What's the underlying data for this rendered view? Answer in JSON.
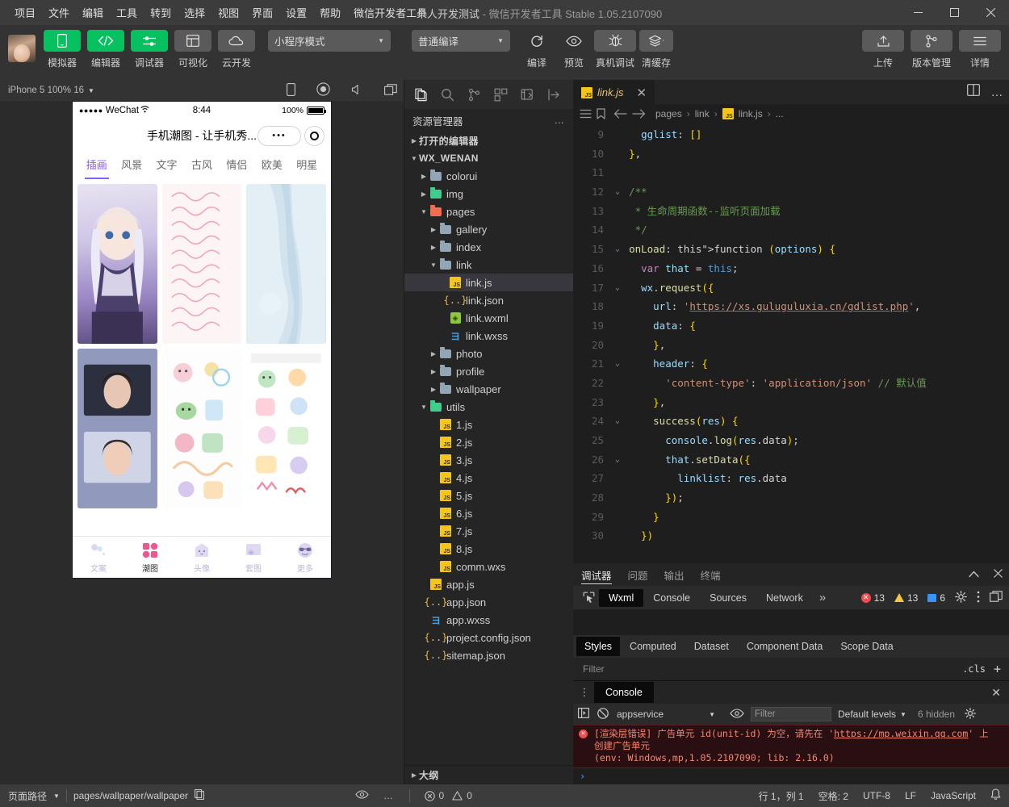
{
  "titlebar": {
    "menus": [
      "项目",
      "文件",
      "编辑",
      "工具",
      "转到",
      "选择",
      "视图",
      "界面",
      "设置",
      "帮助",
      "微信开发者工具"
    ],
    "project_name": "个人开发测试",
    "app_name": "微信开发者工具 Stable 1.05.2107090",
    "separator": "-",
    "minimize": "—",
    "maximize": "▢",
    "close": "✕"
  },
  "toolbar": {
    "buttons": [
      {
        "label": "模拟器",
        "icon": "simulator-icon",
        "style": "green"
      },
      {
        "label": "编辑器",
        "icon": "code-icon",
        "style": "green"
      },
      {
        "label": "调试器",
        "icon": "debugger-icon",
        "style": "green"
      },
      {
        "label": "可视化",
        "icon": "layout-icon",
        "style": "grey"
      },
      {
        "label": "云开发",
        "icon": "cloud-icon",
        "style": "grey"
      }
    ],
    "mode_select": "小程序模式",
    "compile_select": "普通编译",
    "actions": [
      {
        "label": "编译",
        "icon": "refresh-icon"
      },
      {
        "label": "预览",
        "icon": "eye-icon"
      },
      {
        "label": "真机调试",
        "icon": "bug-icon"
      },
      {
        "label": "清缓存",
        "icon": "layers-icon"
      }
    ],
    "right_actions": [
      {
        "label": "上传",
        "icon": "upload-icon"
      },
      {
        "label": "版本管理",
        "icon": "branch-icon"
      },
      {
        "label": "详情",
        "icon": "menu-icon"
      }
    ]
  },
  "simulator": {
    "device_label": "iPhone 5 100% 16",
    "icons": [
      "phone-rotate-icon",
      "record-icon",
      "volume-icon",
      "screenshot-icon"
    ],
    "phone": {
      "status": {
        "signal_dots": "●●●●●",
        "carrier": "WeChat",
        "wifi": "⌃",
        "time": "8:44",
        "battery_pct": "100%"
      },
      "nav_title": "手机潮图 - 让手机秀...",
      "capsule_dots": "•••",
      "categories": [
        {
          "label": "插画",
          "active": true
        },
        {
          "label": "风景",
          "active": false
        },
        {
          "label": "文字",
          "active": false
        },
        {
          "label": "古风",
          "active": false
        },
        {
          "label": "情侣",
          "active": false
        },
        {
          "label": "欧美",
          "active": false
        },
        {
          "label": "明星",
          "active": false
        }
      ],
      "tabbar": [
        {
          "label": "文案",
          "icon": "balloon-icon",
          "active": false
        },
        {
          "label": "潮图",
          "icon": "grid-icon",
          "active": true
        },
        {
          "label": "头像",
          "icon": "ghost-icon",
          "active": false
        },
        {
          "label": "套图",
          "icon": "image-icon",
          "active": false
        },
        {
          "label": "更多",
          "icon": "emoji-icon",
          "active": false
        }
      ]
    }
  },
  "explorer": {
    "activity_icons": [
      "files-icon",
      "search-icon",
      "source-control-icon",
      "extensions-icon",
      "debug-icon",
      "collapse-icon"
    ],
    "title": "资源管理器",
    "more": "…",
    "open_editors": "打开的编辑器",
    "project_root": "WX_WENAN",
    "outline": "大纲",
    "tree": [
      {
        "label": "colorui",
        "depth": 1,
        "type": "folder",
        "arrow": "right",
        "selected": false
      },
      {
        "label": "img",
        "depth": 1,
        "type": "folder-green",
        "arrow": "right",
        "selected": false
      },
      {
        "label": "pages",
        "depth": 1,
        "type": "folder-red",
        "arrow": "down",
        "selected": false
      },
      {
        "label": "gallery",
        "depth": 2,
        "type": "folder",
        "arrow": "right",
        "selected": false
      },
      {
        "label": "index",
        "depth": 2,
        "type": "folder",
        "arrow": "right",
        "selected": false
      },
      {
        "label": "link",
        "depth": 2,
        "type": "folder",
        "arrow": "down",
        "selected": false
      },
      {
        "label": "link.js",
        "depth": 3,
        "type": "js",
        "arrow": "none",
        "selected": true
      },
      {
        "label": "link.json",
        "depth": 3,
        "type": "json",
        "arrow": "none",
        "selected": false
      },
      {
        "label": "link.wxml",
        "depth": 3,
        "type": "wxml",
        "arrow": "none",
        "selected": false
      },
      {
        "label": "link.wxss",
        "depth": 3,
        "type": "wxss",
        "arrow": "none",
        "selected": false
      },
      {
        "label": "photo",
        "depth": 2,
        "type": "folder",
        "arrow": "right",
        "selected": false
      },
      {
        "label": "profile",
        "depth": 2,
        "type": "folder",
        "arrow": "right",
        "selected": false
      },
      {
        "label": "wallpaper",
        "depth": 2,
        "type": "folder",
        "arrow": "right",
        "selected": false
      },
      {
        "label": "utils",
        "depth": 1,
        "type": "folder-green",
        "arrow": "down",
        "selected": false
      },
      {
        "label": "1.js",
        "depth": 2,
        "type": "js",
        "arrow": "none",
        "selected": false
      },
      {
        "label": "2.js",
        "depth": 2,
        "type": "js",
        "arrow": "none",
        "selected": false
      },
      {
        "label": "3.js",
        "depth": 2,
        "type": "js",
        "arrow": "none",
        "selected": false
      },
      {
        "label": "4.js",
        "depth": 2,
        "type": "js",
        "arrow": "none",
        "selected": false
      },
      {
        "label": "5.js",
        "depth": 2,
        "type": "js",
        "arrow": "none",
        "selected": false
      },
      {
        "label": "6.js",
        "depth": 2,
        "type": "js",
        "arrow": "none",
        "selected": false
      },
      {
        "label": "7.js",
        "depth": 2,
        "type": "js",
        "arrow": "none",
        "selected": false
      },
      {
        "label": "8.js",
        "depth": 2,
        "type": "js",
        "arrow": "none",
        "selected": false
      },
      {
        "label": "comm.wxs",
        "depth": 2,
        "type": "js",
        "arrow": "none",
        "selected": false
      },
      {
        "label": "app.js",
        "depth": 1,
        "type": "js",
        "arrow": "none",
        "selected": false
      },
      {
        "label": "app.json",
        "depth": 1,
        "type": "json",
        "arrow": "none",
        "selected": false
      },
      {
        "label": "app.wxss",
        "depth": 1,
        "type": "wxss",
        "arrow": "none",
        "selected": false
      },
      {
        "label": "project.config.json",
        "depth": 1,
        "type": "json",
        "arrow": "none",
        "selected": false
      },
      {
        "label": "sitemap.json",
        "depth": 1,
        "type": "json",
        "arrow": "none",
        "selected": false
      }
    ]
  },
  "editor": {
    "tab_label": "link.js",
    "tab_close": "✕",
    "split_icon": "split-editor-icon",
    "more_icon": "more-actions-icon",
    "breadcrumb": [
      "pages",
      "link",
      "link.js",
      "..."
    ],
    "first_line_number": 9,
    "lines": [
      {
        "n": 9,
        "fold": false
      },
      {
        "n": 10,
        "fold": false
      },
      {
        "n": 11,
        "fold": false
      },
      {
        "n": 12,
        "fold": true
      },
      {
        "n": 13,
        "fold": false
      },
      {
        "n": 14,
        "fold": false
      },
      {
        "n": 15,
        "fold": true
      },
      {
        "n": 16,
        "fold": false
      },
      {
        "n": 17,
        "fold": true
      },
      {
        "n": 18,
        "fold": false
      },
      {
        "n": 19,
        "fold": false
      },
      {
        "n": 20,
        "fold": false
      },
      {
        "n": 21,
        "fold": true
      },
      {
        "n": 22,
        "fold": false
      },
      {
        "n": 23,
        "fold": false
      },
      {
        "n": 24,
        "fold": true
      },
      {
        "n": 25,
        "fold": false
      },
      {
        "n": 26,
        "fold": true
      },
      {
        "n": 27,
        "fold": false
      },
      {
        "n": 28,
        "fold": false
      },
      {
        "n": 29,
        "fold": false
      },
      {
        "n": 30,
        "fold": false
      }
    ],
    "source_text": [
      "    gglist: []",
      "  },",
      "",
      "  /**",
      "   * 生命周期函数--监听页面加载",
      "   */",
      "  onLoad: function (options) {",
      "    var that = this;",
      "    wx.request({",
      "      url: 'https://xs.guluguluxia.cn/gdlist.php',",
      "      data: {",
      "      },",
      "      header: {",
      "        'content-type': 'application/json' // 默认值",
      "      },",
      "      success(res) {",
      "        console.log(res.data);",
      "        that.setData({",
      "          linklist: res.data",
      "        });",
      "      }",
      "    })"
    ]
  },
  "debugger": {
    "panel_tabs": [
      {
        "label": "调试器",
        "active": true
      },
      {
        "label": "问题",
        "active": false
      },
      {
        "label": "输出",
        "active": false
      },
      {
        "label": "终端",
        "active": false
      }
    ],
    "collapse_icon": "chevron-up-icon",
    "close_icon": "close-icon",
    "devtools_tabs": [
      {
        "label": "Wxml",
        "active": true
      },
      {
        "label": "Console",
        "active": false
      },
      {
        "label": "Sources",
        "active": false
      },
      {
        "label": "Network",
        "active": false
      }
    ],
    "overflow": "»",
    "counts": {
      "errors": "13",
      "warnings": "13",
      "infos": "6"
    },
    "settings_icon": "gear-icon",
    "kebab_icon": "kebab-menu-icon",
    "dock_icon": "dock-icon",
    "style_tabs": [
      {
        "label": "Styles",
        "active": true
      },
      {
        "label": "Computed",
        "active": false
      },
      {
        "label": "Dataset",
        "active": false
      },
      {
        "label": "Component Data",
        "active": false
      },
      {
        "label": "Scope Data",
        "active": false
      }
    ],
    "filter_placeholder": "Filter",
    "cls_label": ".cls",
    "add_label": "+"
  },
  "console": {
    "title": "Console",
    "close": "✕",
    "context": "appservice",
    "filter_placeholder": "Filter",
    "levels": "Default levels",
    "hidden": "6 hidden",
    "error_line1_a": "[渲染层错误] 广告单元 id(unit-id) 为空，请先在 '",
    "error_link": "https://mp.weixin.qq.com",
    "error_line1_b": "' 上",
    "error_line2": "创建广告单元",
    "error_line3": "(env: Windows,mp,1.05.2107090; lib: 2.16.0)",
    "prompt": "›"
  },
  "statusbar": {
    "page_path_label": "页面路径",
    "page_path": "pages/wallpaper/wallpaper",
    "copy_icon": "copy-icon",
    "eye_icon": "eye-icon",
    "more_icon": "more-icon",
    "problem_errors": "0",
    "problem_warnings": "0",
    "cursor": "行 1，列 1",
    "spaces": "空格: 2",
    "encoding": "UTF-8",
    "eol": "LF",
    "language": "JavaScript",
    "bell_icon": "bell-icon"
  },
  "colors": {
    "accent_green": "#07c160",
    "purple": "#8a5cf5",
    "error_red": "#f14c4c",
    "warn_yellow": "#f2c744",
    "info_blue": "#3794ff"
  }
}
